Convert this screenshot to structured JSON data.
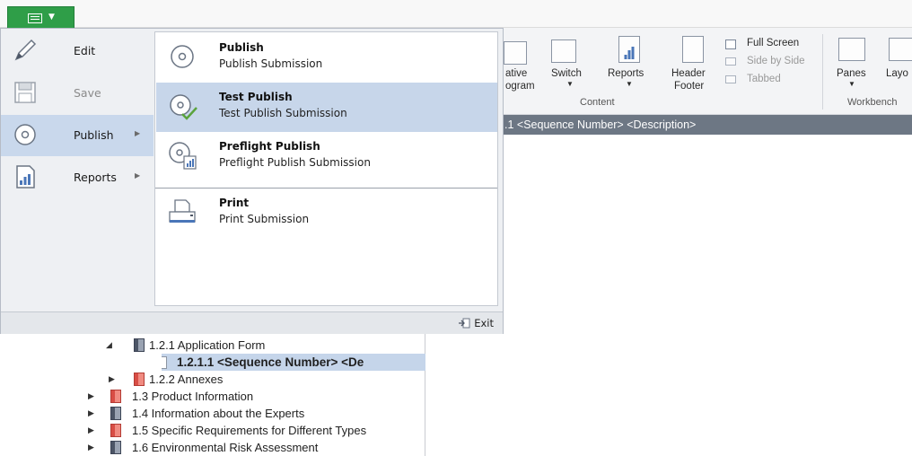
{
  "ribbon": {
    "items": [
      {
        "label": "ative"
      },
      {
        "label": "ogram"
      },
      {
        "label": "Switch"
      },
      {
        "label": "Reports"
      },
      {
        "label": "Header"
      },
      {
        "label": "Footer"
      },
      {
        "label": "Full Screen"
      },
      {
        "label": "Side by Side"
      },
      {
        "label": "Tabbed"
      },
      {
        "label": "Panes"
      },
      {
        "label": "Layo"
      }
    ],
    "groups": {
      "content": "Content",
      "workbench": "Workbench"
    }
  },
  "doc_bar": {
    "title": ".1 <Sequence Number> <Description>"
  },
  "menu": {
    "left_items": [
      {
        "label": "Edit",
        "icon": "pencil-icon",
        "state": "normal"
      },
      {
        "label": "Save",
        "icon": "floppy-disk-icon",
        "state": "disabled"
      },
      {
        "label": "Publish",
        "icon": "disc-icon",
        "state": "active"
      },
      {
        "label": "Reports",
        "icon": "report-chart-icon",
        "state": "normal"
      }
    ],
    "submenu": [
      {
        "title": "Publish",
        "desc": "Publish Submission",
        "icon": "disc-icon"
      },
      {
        "title": "Test Publish",
        "desc": "Test Publish Submission",
        "icon": "disc-check-icon",
        "active": true
      },
      {
        "title": "Preflight Publish",
        "desc": "Preflight Publish Submission",
        "icon": "disc-chart-icon"
      },
      {
        "title": "Print",
        "desc": "Print Submission",
        "icon": "printer-icon"
      }
    ],
    "exit_label": "Exit"
  },
  "tree": {
    "rows": [
      {
        "text": "1.2.1 Application Form",
        "expander": "open",
        "icon": "book"
      },
      {
        "text": "1.2.1.1 <Sequence Number> <De",
        "expander": "none",
        "icon": "page",
        "selected": true
      },
      {
        "text": "1.2.2 Annexes",
        "expander": "closed",
        "icon": "redbook"
      },
      {
        "text": "1.3 Product Information",
        "expander": "closed",
        "icon": "redbook"
      },
      {
        "text": "1.4 Information about the Experts",
        "expander": "closed",
        "icon": "book"
      },
      {
        "text": "1.5 Specific Requirements for Different Types",
        "expander": "closed",
        "icon": "redbook"
      },
      {
        "text": "1.6 Environmental Risk Assessment",
        "expander": "closed",
        "icon": "book"
      }
    ]
  },
  "colors": {
    "accent_green": "#2f9e48",
    "selection_blue": "#c7d6ea",
    "doc_bar": "#6d7784"
  }
}
